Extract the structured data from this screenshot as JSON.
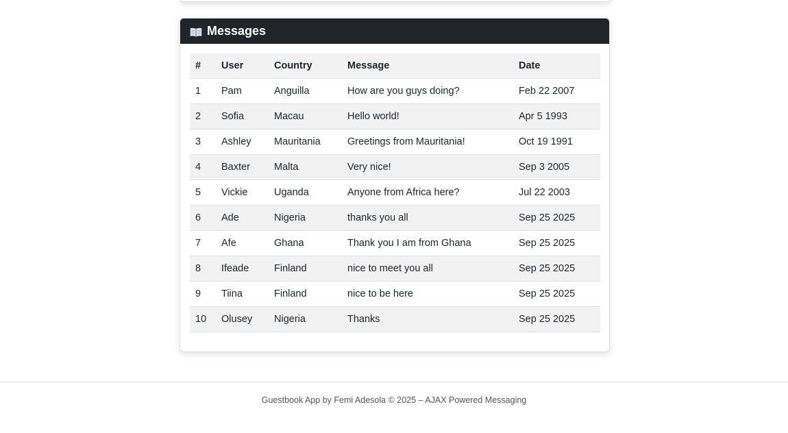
{
  "messages_card": {
    "title": "Messages",
    "icon": "open-book-icon"
  },
  "table": {
    "headers": {
      "num": "#",
      "user": "User",
      "country": "Country",
      "message": "Message",
      "date": "Date"
    },
    "rows": [
      {
        "num": "1",
        "user": "Pam",
        "country": "Anguilla",
        "message": "How are you guys doing?",
        "date": "Feb 22 2007"
      },
      {
        "num": "2",
        "user": "Sofia",
        "country": "Macau",
        "message": "Hello world!",
        "date": "Apr 5 1993"
      },
      {
        "num": "3",
        "user": "Ashley",
        "country": "Mauritania",
        "message": "Greetings from Mauritania!",
        "date": "Oct 19 1991"
      },
      {
        "num": "4",
        "user": "Baxter",
        "country": "Malta",
        "message": "Very nice!",
        "date": "Sep 3 2005"
      },
      {
        "num": "5",
        "user": "Vickie",
        "country": "Uganda",
        "message": "Anyone from Africa here?",
        "date": "Jul 22 2003"
      },
      {
        "num": "6",
        "user": "Ade",
        "country": "Nigeria",
        "message": "thanks you all",
        "date": "Sep 25 2025"
      },
      {
        "num": "7",
        "user": "Afe",
        "country": "Ghana",
        "message": "Thank you I am from Ghana",
        "date": "Sep 25 2025"
      },
      {
        "num": "8",
        "user": "Ifeade",
        "country": "Finland",
        "message": "nice to meet you all",
        "date": "Sep 25 2025"
      },
      {
        "num": "9",
        "user": "Tiina",
        "country": "Finland",
        "message": "nice to be here",
        "date": "Sep 25 2025"
      },
      {
        "num": "10",
        "user": "Olusey",
        "country": "Nigeria",
        "message": "Thanks",
        "date": "Sep 25 2025"
      }
    ]
  },
  "footer": {
    "text": "Guestbook App by Femi Adesola © 2025 – AJAX Powered Messaging"
  },
  "colors": {
    "header_bg": "#212529",
    "stripe": "#f2f2f2"
  }
}
